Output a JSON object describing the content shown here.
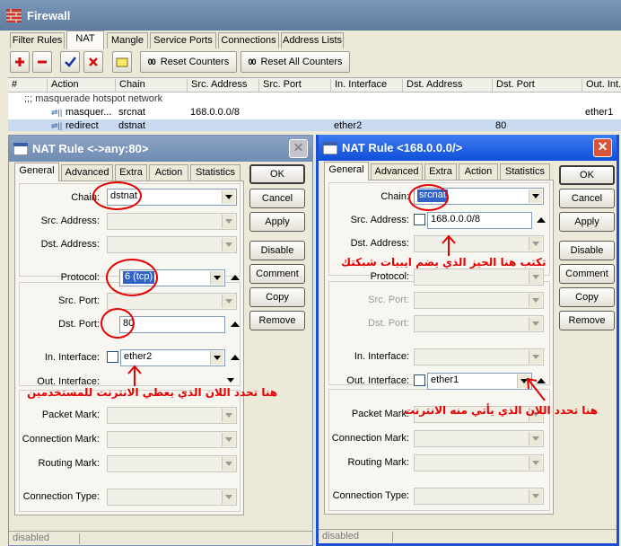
{
  "window": {
    "title": "Firewall"
  },
  "tabs": [
    "Filter Rules",
    "NAT",
    "Mangle",
    "Service Ports",
    "Connections",
    "Address Lists"
  ],
  "toolbar": {
    "reset_counters": "Reset Counters",
    "reset_all_counters": "Reset All Counters",
    "counter_glyph": "00"
  },
  "table": {
    "columns": [
      "#",
      "Action",
      "Chain",
      "Src. Address",
      "Src. Port",
      "In. Interface",
      "Dst. Address",
      "Dst. Port",
      "Out. Int..."
    ],
    "comment": ";;; masquerade hotspot network",
    "rows": [
      {
        "action": "masquer...",
        "chain": "srcnat",
        "src_address": "168.0.0.0/8",
        "in_interface": "",
        "dst_port": "",
        "out_interface": "ether1",
        "selected": false
      },
      {
        "action": "redirect",
        "chain": "dstnat",
        "src_address": "",
        "in_interface": "ether2",
        "dst_port": "80",
        "out_interface": "",
        "selected": true
      }
    ]
  },
  "left_dialog": {
    "title": "NAT Rule <->any:80>",
    "tabs": [
      "General",
      "Advanced",
      "Extra",
      "Action",
      "Statistics"
    ],
    "fields": {
      "chain_label": "Chain:",
      "chain": "dstnat",
      "src_address_label": "Src. Address:",
      "dst_address_label": "Dst. Address:",
      "protocol_label": "Protocol:",
      "protocol": "6 (tcp)",
      "src_port_label": "Src. Port:",
      "dst_port_label": "Dst. Port:",
      "dst_port": "80",
      "in_interface_label": "In. Interface:",
      "in_interface": "ether2",
      "out_interface_label": "Out. Interface:",
      "packet_mark_label": "Packet Mark:",
      "connection_mark_label": "Connection Mark:",
      "routing_mark_label": "Routing Mark:",
      "connection_type_label": "Connection Type:"
    },
    "buttons": [
      "OK",
      "Cancel",
      "Apply",
      "Disable",
      "Comment",
      "Copy",
      "Remove"
    ],
    "status": "disabled",
    "annotation": "هنا تحدد اللان الذي يعطي الانترنت للمستخدمين"
  },
  "right_dialog": {
    "title": "NAT Rule <168.0.0.0/>",
    "tabs": [
      "General",
      "Advanced",
      "Extra",
      "Action",
      "Statistics"
    ],
    "fields": {
      "chain_label": "Chain:",
      "chain": "srcnat",
      "src_address_label": "Src. Address:",
      "src_address": "168.0.0.0/8",
      "dst_address_label": "Dst. Address:",
      "protocol_label": "Protocol:",
      "src_port_label": "Src. Port:",
      "dst_port_label": "Dst. Port:",
      "in_interface_label": "In. Interface:",
      "out_interface_label": "Out. Interface:",
      "out_interface": "ether1",
      "packet_mark_label": "Packet Mark:",
      "connection_mark_label": "Connection Mark:",
      "routing_mark_label": "Routing Mark:",
      "connection_type_label": "Connection Type:"
    },
    "buttons": [
      "OK",
      "Cancel",
      "Apply",
      "Disable",
      "Comment",
      "Copy",
      "Remove"
    ],
    "status": "disabled",
    "annotation_1": "تكتب هنا الحيز الذي يضم ايبيات شبكتك",
    "annotation_2": "هنا تحدد اللان الذي يأتي منه الانترنت"
  },
  "colors": {
    "annotation": "#e60000",
    "active_title": "#0f4fd9",
    "inactive_title": "#6f8cb3",
    "selection": "#c9d9ef"
  }
}
